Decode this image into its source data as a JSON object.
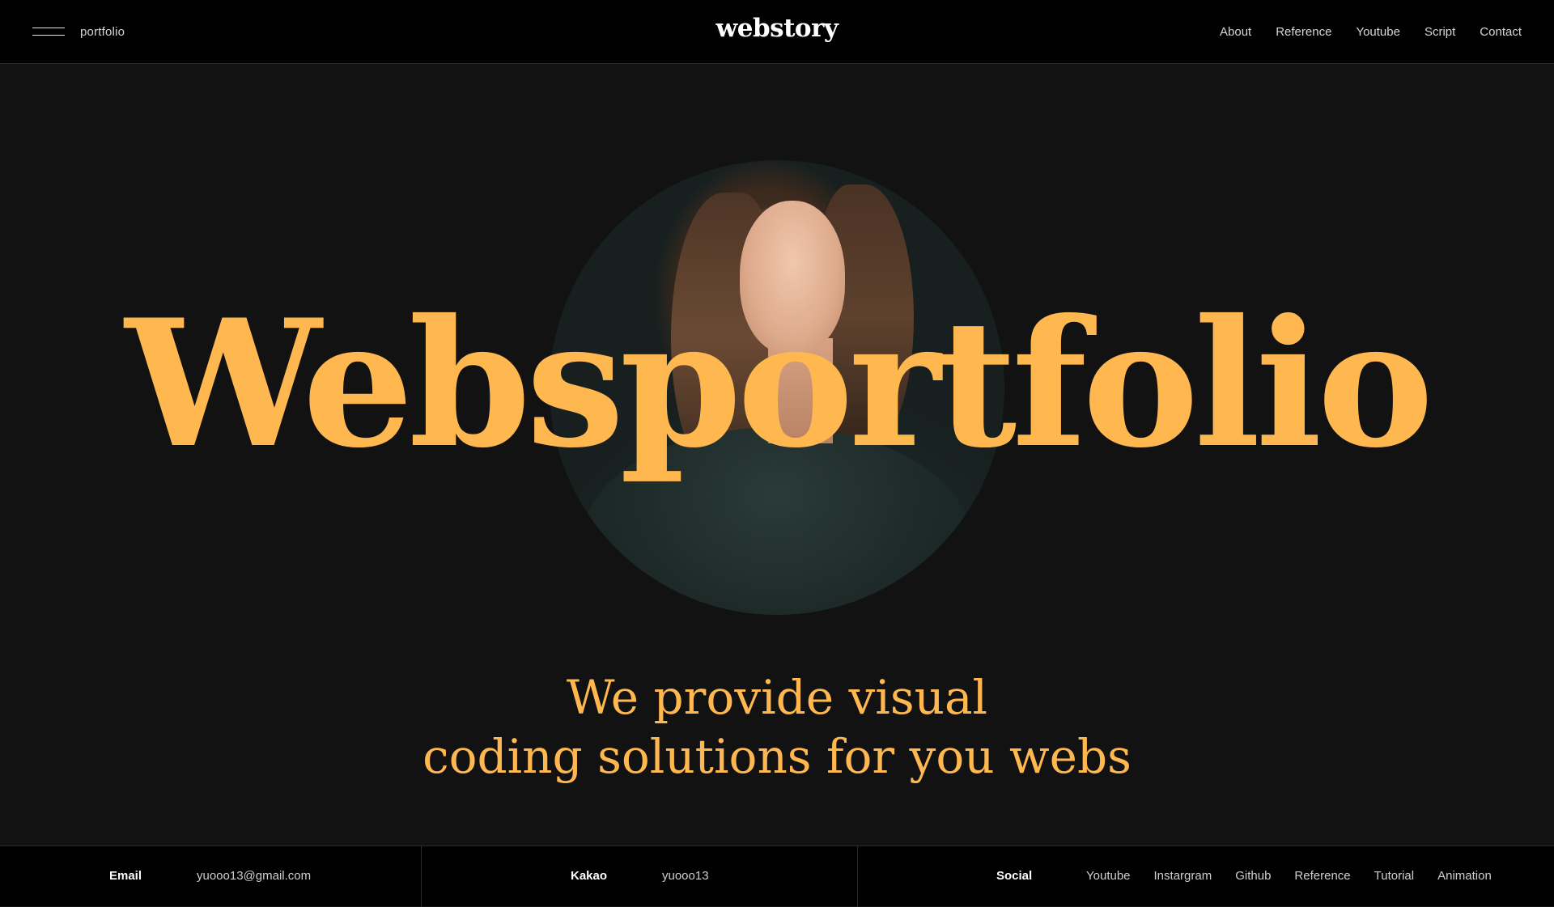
{
  "header": {
    "subtitle": "portfolio",
    "logo": "webstory",
    "nav": [
      "About",
      "Reference",
      "Youtube",
      "Script",
      "Contact"
    ]
  },
  "hero": {
    "title": "Websportfolio",
    "subtitle_line1": "We provide visual",
    "subtitle_line2": "coding solutions for you webs",
    "accent_color": "#ffb84f"
  },
  "footer": {
    "email_label": "Email",
    "email_value": "yuooo13@gmail.com",
    "kakao_label": "Kakao",
    "kakao_value": "yuooo13",
    "social_label": "Social",
    "social_links": [
      "Youtube",
      "Instargram",
      "Github",
      "Reference",
      "Tutorial",
      "Animation"
    ]
  },
  "icons": {
    "menu": "hamburger-menu-icon"
  },
  "colors": {
    "background": "#121212",
    "bar": "#000000",
    "accent": "#ffb84f"
  }
}
